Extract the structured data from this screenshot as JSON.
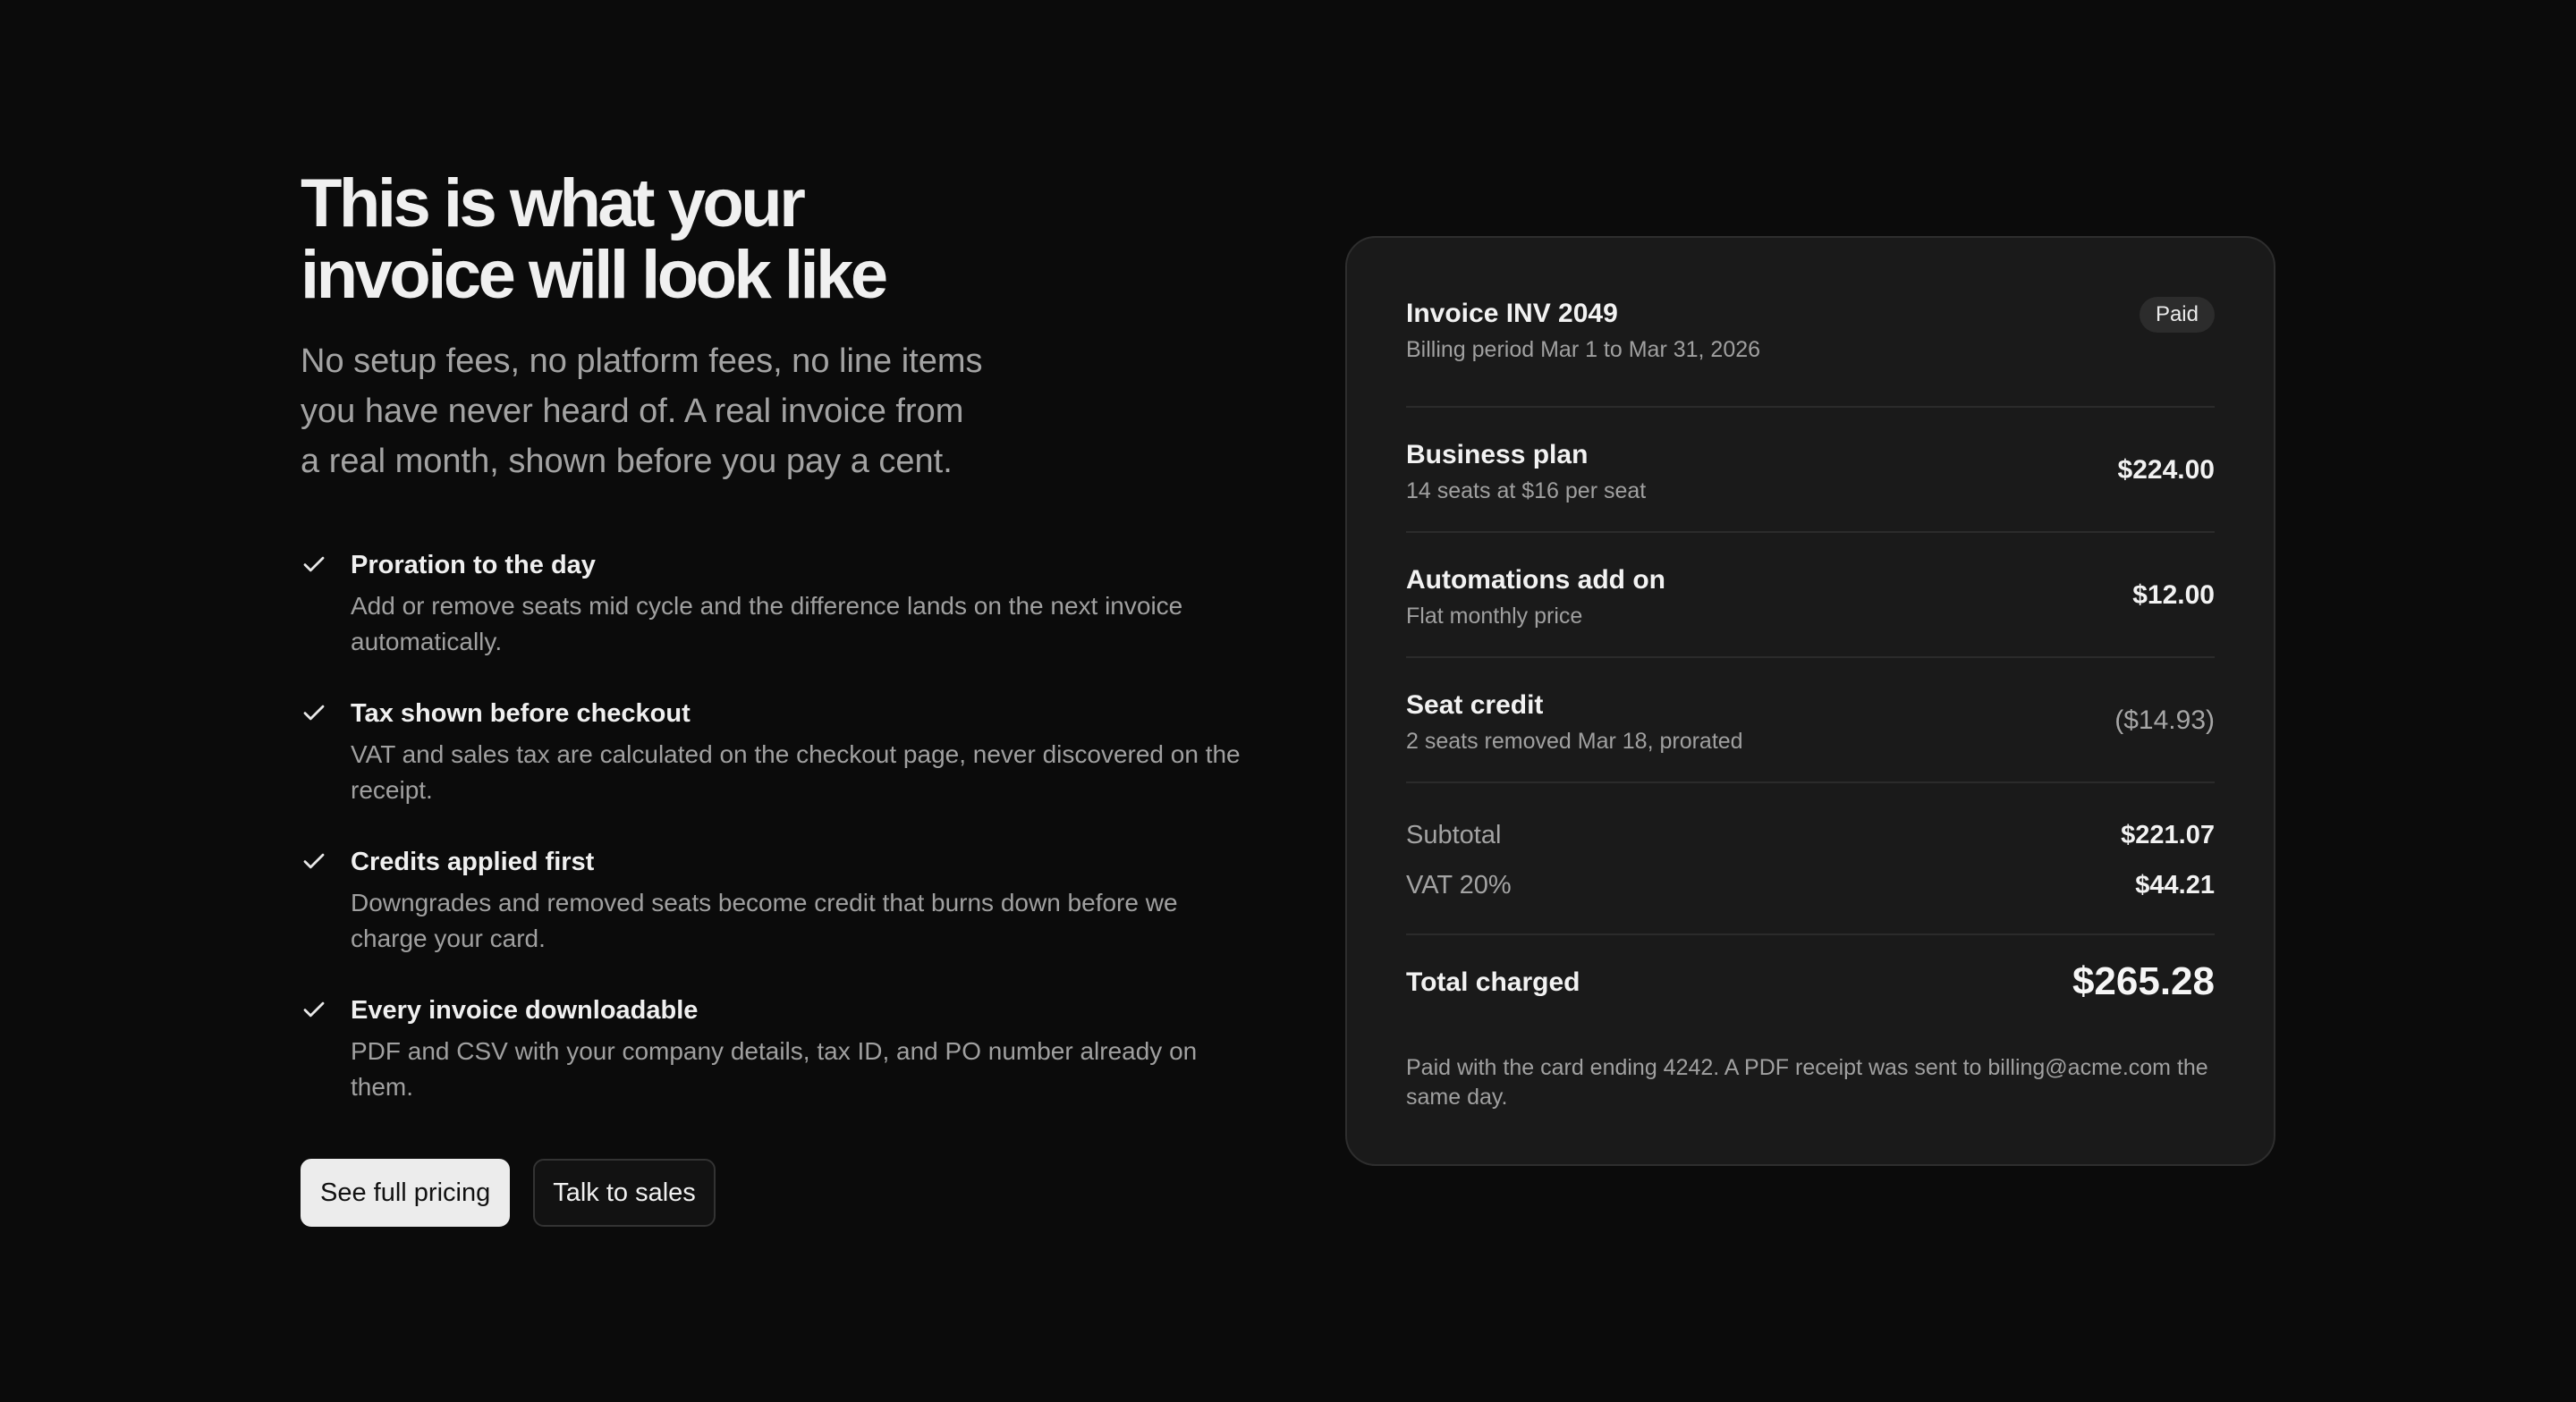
{
  "hero": {
    "headline_line1": "This is what your",
    "headline_line2": "invoice will look like",
    "subhead_line1": "No setup fees, no platform fees, no line items",
    "subhead_line2": "you have never heard of. A real invoice from",
    "subhead_line3": "a real month, shown before you pay a cent."
  },
  "features": [
    {
      "icon": "check-icon",
      "title": "Proration to the day",
      "description": "Add or remove seats mid cycle and the difference lands on the next invoice automatically."
    },
    {
      "icon": "check-icon",
      "title": "Tax shown before checkout",
      "description": "VAT and sales tax are calculated on the checkout page, never discovered on the receipt."
    },
    {
      "icon": "check-icon",
      "title": "Credits applied first",
      "description": "Downgrades and removed seats become credit that burns down before we charge your card."
    },
    {
      "icon": "check-icon",
      "title": "Every invoice downloadable",
      "description": "PDF and CSV with your company details, tax ID, and PO number already on them."
    }
  ],
  "buttons": {
    "primary": "See full pricing",
    "secondary": "Talk to sales"
  },
  "invoice": {
    "title": "Invoice INV 2049",
    "billing_period": "Billing period Mar 1 to Mar 31, 2026",
    "status": "Paid",
    "items": [
      {
        "name": "Business plan",
        "detail": "14 seats at $16 per seat",
        "amount": "$224.00"
      },
      {
        "name": "Automations add on",
        "detail": "Flat monthly price",
        "amount": "$12.00"
      },
      {
        "name": "Seat credit",
        "detail": "2 seats removed Mar 18, prorated",
        "amount": "($14.93)"
      }
    ],
    "subtotal_label": "Subtotal",
    "subtotal_value": "$221.07",
    "tax_label": "VAT 20%",
    "tax_value": "$44.21",
    "total_label": "Total charged",
    "total_value": "$265.28",
    "footnote": "Paid with the card ending 4242. A PDF receipt was sent to billing@acme.com the same day."
  },
  "colors": {
    "background": "#0b0b0b",
    "card": "#1a1a1a",
    "text_primary": "#f0f0f0",
    "text_muted": "#a0a0a0",
    "button_primary_bg": "#ececec"
  }
}
